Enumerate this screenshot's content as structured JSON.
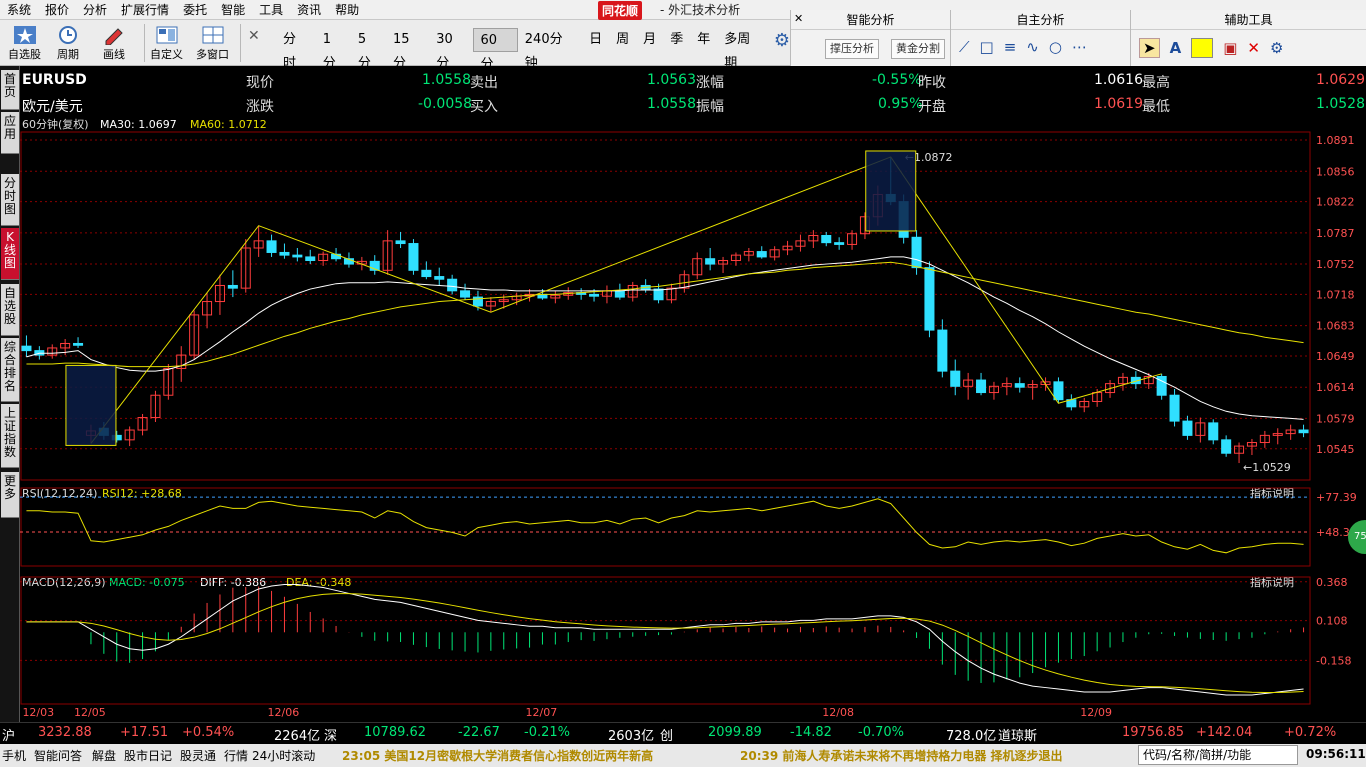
{
  "menu": [
    "系统",
    "报价",
    "分析",
    "扩展行情",
    "委托",
    "智能",
    "工具",
    "资讯",
    "帮助"
  ],
  "app": {
    "brand": "同花顺",
    "title": "- 外汇技术分析"
  },
  "toolbar": {
    "tools": [
      "自选股",
      "周期",
      "画线",
      "自定义",
      "多窗口"
    ],
    "periods": [
      "分时",
      "1分",
      "5分",
      "15分",
      "30分",
      "60分",
      "240分钟",
      "日",
      "周",
      "月",
      "季",
      "年",
      "多周期"
    ],
    "active_period": "60分"
  },
  "panels": {
    "smart": {
      "title": "智能分析",
      "buttons": [
        "撑压分析",
        "黄金分割"
      ]
    },
    "self": {
      "title": "自主分析"
    },
    "aux": {
      "title": "辅助工具"
    }
  },
  "sidetabs": [
    "首页",
    "应用",
    "分时图",
    "K线图",
    "自选股",
    "综合排名",
    "上证指数",
    "更多"
  ],
  "quote": {
    "symbol": "EURUSD",
    "name": "欧元/美元",
    "labels": {
      "now": "现价",
      "change": "涨跌",
      "sell": "卖出",
      "buy": "买入",
      "pct": "涨幅",
      "amp": "振幅",
      "prev": "昨收",
      "open": "开盘",
      "high": "最高",
      "low": "最低"
    },
    "now": "1.0558",
    "change": "-0.0058",
    "sell": "1.0563",
    "buy": "1.0558",
    "pct": "-0.55%",
    "amp": "0.95%",
    "prev": "1.0616",
    "open": "1.0619",
    "high": "1.0629",
    "low": "1.0528"
  },
  "ma_line": {
    "period": "60分钟(复权)",
    "ma30": "MA30: 1.0697",
    "ma60": "MA60: 1.0712"
  },
  "rsi_line": {
    "text": "RSI(12,12,24)",
    "value": "RSI12: +28.68"
  },
  "macd_line": {
    "text": "MACD(12,26,9)",
    "macd": "MACD: -0.075",
    "diff": "DIFF: -0.386",
    "dea": "DEA: -0.348"
  },
  "indicator_help": "指标说明",
  "colors": {
    "up": "#ff3d3d",
    "down": "#30e0ff",
    "ma30": "#ffffff",
    "ma60": "#e6e000",
    "grid": "#8b0000"
  },
  "chart_data": [
    {
      "type": "candlestick",
      "title": "EURUSD 60分钟",
      "x_labels": [
        "12/03",
        "12/05",
        "12/06",
        "12/07",
        "12/08",
        "12/09"
      ],
      "yticks": [
        "1.0891",
        "1.0856",
        "1.0822",
        "1.0787",
        "1.0752",
        "1.0718",
        "1.0683",
        "1.0649",
        "1.0614",
        "1.0579",
        "1.0545"
      ],
      "ylim": [
        1.051,
        1.09
      ],
      "annotations": [
        "1.0872",
        "1.0529"
      ],
      "candles": [
        [
          1.066,
          1.0672,
          1.0648,
          1.0655
        ],
        [
          1.0655,
          1.066,
          1.0645,
          1.065
        ],
        [
          1.065,
          1.0662,
          1.0646,
          1.0658
        ],
        [
          1.0658,
          1.0668,
          1.065,
          1.0663
        ],
        [
          1.0663,
          1.067,
          1.0658,
          1.0661
        ],
        [
          1.056,
          1.0572,
          1.0551,
          1.0565
        ],
        [
          1.0568,
          1.0575,
          1.0555,
          1.056
        ],
        [
          1.056,
          1.0565,
          1.0552,
          1.0555
        ],
        [
          1.0555,
          1.057,
          1.0548,
          1.0566
        ],
        [
          1.0566,
          1.0584,
          1.056,
          1.058
        ],
        [
          1.058,
          1.061,
          1.0575,
          1.0605
        ],
        [
          1.0605,
          1.064,
          1.06,
          1.0635
        ],
        [
          1.0635,
          1.066,
          1.062,
          1.065
        ],
        [
          1.065,
          1.07,
          1.0645,
          1.0695
        ],
        [
          1.0695,
          1.072,
          1.068,
          1.071
        ],
        [
          1.071,
          1.074,
          1.0695,
          1.0728
        ],
        [
          1.0728,
          1.0745,
          1.0715,
          1.0725
        ],
        [
          1.0725,
          1.078,
          1.072,
          1.077
        ],
        [
          1.077,
          1.0795,
          1.076,
          1.0778
        ],
        [
          1.0778,
          1.0785,
          1.076,
          1.0765
        ],
        [
          1.0765,
          1.0775,
          1.0758,
          1.0762
        ],
        [
          1.0762,
          1.077,
          1.0755,
          1.076
        ],
        [
          1.076,
          1.0768,
          1.0752,
          1.0756
        ],
        [
          1.0756,
          1.0766,
          1.075,
          1.0763
        ],
        [
          1.0763,
          1.077,
          1.0755,
          1.0758
        ],
        [
          1.0758,
          1.0765,
          1.0748,
          1.0752
        ],
        [
          1.0752,
          1.076,
          1.0745,
          1.0755
        ],
        [
          1.0755,
          1.0762,
          1.074,
          1.0745
        ],
        [
          1.0745,
          1.079,
          1.074,
          1.0778
        ],
        [
          1.0778,
          1.0788,
          1.077,
          1.0775
        ],
        [
          1.0775,
          1.078,
          1.074,
          1.0745
        ],
        [
          1.0745,
          1.0755,
          1.0735,
          1.0738
        ],
        [
          1.0738,
          1.0748,
          1.0728,
          1.0735
        ],
        [
          1.0735,
          1.074,
          1.0718,
          1.0722
        ],
        [
          1.0722,
          1.073,
          1.0712,
          1.0715
        ],
        [
          1.0715,
          1.0722,
          1.07,
          1.0705
        ],
        [
          1.0705,
          1.0715,
          1.0698,
          1.071
        ],
        [
          1.071,
          1.0718,
          1.0702,
          1.0712
        ],
        [
          1.0712,
          1.072,
          1.0706,
          1.0716
        ],
        [
          1.0716,
          1.0724,
          1.071,
          1.0718
        ],
        [
          1.0718,
          1.0724,
          1.0712,
          1.0714
        ],
        [
          1.0714,
          1.0722,
          1.0708,
          1.0717
        ],
        [
          1.0717,
          1.0726,
          1.0712,
          1.072
        ],
        [
          1.072,
          1.0725,
          1.0712,
          1.0718
        ],
        [
          1.0718,
          1.0724,
          1.071,
          1.0716
        ],
        [
          1.0716,
          1.0728,
          1.0708,
          1.0722
        ],
        [
          1.0722,
          1.073,
          1.0712,
          1.0715
        ],
        [
          1.0715,
          1.0732,
          1.071,
          1.0728
        ],
        [
          1.0728,
          1.0735,
          1.072,
          1.0724
        ],
        [
          1.0724,
          1.073,
          1.0708,
          1.0712
        ],
        [
          1.0712,
          1.073,
          1.0708,
          1.0725
        ],
        [
          1.0725,
          1.0745,
          1.072,
          1.074
        ],
        [
          1.074,
          1.0765,
          1.0735,
          1.0758
        ],
        [
          1.0758,
          1.077,
          1.0745,
          1.0752
        ],
        [
          1.0752,
          1.076,
          1.0742,
          1.0756
        ],
        [
          1.0756,
          1.0765,
          1.075,
          1.0762
        ],
        [
          1.0762,
          1.077,
          1.0755,
          1.0766
        ],
        [
          1.0766,
          1.0772,
          1.0758,
          1.076
        ],
        [
          1.076,
          1.0772,
          1.0756,
          1.0768
        ],
        [
          1.0768,
          1.0778,
          1.0762,
          1.0772
        ],
        [
          1.0772,
          1.0785,
          1.0766,
          1.0778
        ],
        [
          1.0778,
          1.079,
          1.077,
          1.0784
        ],
        [
          1.0784,
          1.0788,
          1.0772,
          1.0776
        ],
        [
          1.0776,
          1.0782,
          1.0768,
          1.0774
        ],
        [
          1.0774,
          1.079,
          1.0768,
          1.0786
        ],
        [
          1.0786,
          1.081,
          1.078,
          1.0805
        ],
        [
          1.0805,
          1.084,
          1.0795,
          1.083
        ],
        [
          1.083,
          1.0872,
          1.0818,
          1.0822
        ],
        [
          1.0822,
          1.083,
          1.0775,
          1.0782
        ],
        [
          1.0782,
          1.079,
          1.074,
          1.0748
        ],
        [
          1.0748,
          1.0755,
          1.067,
          1.0678
        ],
        [
          1.0678,
          1.069,
          1.0625,
          1.0632
        ],
        [
          1.0632,
          1.0645,
          1.0605,
          1.0615
        ],
        [
          1.0615,
          1.063,
          1.06,
          1.0622
        ],
        [
          1.0622,
          1.063,
          1.0605,
          1.0608
        ],
        [
          1.0608,
          1.062,
          1.06,
          1.0615
        ],
        [
          1.0615,
          1.0625,
          1.0605,
          1.0618
        ],
        [
          1.0618,
          1.0625,
          1.0608,
          1.0614
        ],
        [
          1.0614,
          1.0622,
          1.06,
          1.0617
        ],
        [
          1.0617,
          1.0625,
          1.061,
          1.062
        ],
        [
          1.062,
          1.0625,
          1.0596,
          1.06
        ],
        [
          1.06,
          1.0606,
          1.0588,
          1.0592
        ],
        [
          1.0592,
          1.0602,
          1.0586,
          1.0598
        ],
        [
          1.0598,
          1.0612,
          1.0592,
          1.0608
        ],
        [
          1.0608,
          1.0622,
          1.0602,
          1.0618
        ],
        [
          1.0618,
          1.063,
          1.061,
          1.0625
        ],
        [
          1.0625,
          1.0632,
          1.0612,
          1.0618
        ],
        [
          1.0618,
          1.063,
          1.0612,
          1.0626
        ],
        [
          1.0626,
          1.0629,
          1.06,
          1.0605
        ],
        [
          1.0605,
          1.0612,
          1.057,
          1.0576
        ],
        [
          1.0576,
          1.0582,
          1.0555,
          1.056
        ],
        [
          1.056,
          1.058,
          1.0552,
          1.0574
        ],
        [
          1.0574,
          1.0578,
          1.055,
          1.0555
        ],
        [
          1.0555,
          1.056,
          1.0536,
          1.054
        ],
        [
          1.054,
          1.0552,
          1.0529,
          1.0548
        ],
        [
          1.0548,
          1.0556,
          1.0538,
          1.0552
        ],
        [
          1.0552,
          1.0565,
          1.0546,
          1.056
        ],
        [
          1.056,
          1.0568,
          1.055,
          1.0562
        ],
        [
          1.0562,
          1.0572,
          1.0555,
          1.0566
        ],
        [
          1.0566,
          1.0572,
          1.0558,
          1.0563
        ]
      ],
      "ma30": [
        1.0648,
        1.0652,
        1.0652,
        1.0653,
        1.0655,
        1.0645,
        1.064,
        1.0636,
        1.0633,
        1.0632,
        1.0632,
        1.0634,
        1.0638,
        1.0645,
        1.0655,
        1.0665,
        1.0676,
        1.0686,
        1.0697,
        1.0706,
        1.0713,
        1.0719,
        1.0724,
        1.0727,
        1.073,
        1.0731,
        1.0731,
        1.0731,
        1.0732,
        1.0731,
        1.073,
        1.0729,
        1.0728,
        1.0727,
        1.0725,
        1.0724,
        1.0723,
        1.0723,
        1.0722,
        1.0722,
        1.0722,
        1.0722,
        1.0722,
        1.0722,
        1.0722,
        1.0722,
        1.0722,
        1.0723,
        1.0723,
        1.0723,
        1.0724,
        1.0726,
        1.0729,
        1.0732,
        1.0735,
        1.0738,
        1.0741,
        1.0743,
        1.0745,
        1.0747,
        1.0749,
        1.0751,
        1.0752,
        1.0753,
        1.0754,
        1.0756,
        1.0758,
        1.076,
        1.076,
        1.0757,
        1.0752,
        1.0745,
        1.0738,
        1.0731,
        1.0723,
        1.0715,
        1.0708,
        1.07,
        1.0693,
        1.0685,
        1.0676,
        1.0668,
        1.066,
        1.0653,
        1.0646,
        1.064,
        1.0634,
        1.0628,
        1.0621,
        1.0614,
        1.0606,
        1.0598,
        1.0592,
        1.0587,
        1.0584,
        1.0582,
        1.0581,
        1.058,
        1.0579,
        1.0578
      ],
      "ma60": [
        1.064,
        1.064,
        1.064,
        1.0641,
        1.0641,
        1.064,
        1.0639,
        1.0638,
        1.0637,
        1.0637,
        1.0637,
        1.0637,
        1.0638,
        1.064,
        1.0643,
        1.0647,
        1.0651,
        1.0656,
        1.0661,
        1.0666,
        1.0671,
        1.0675,
        1.068,
        1.0684,
        1.0688,
        1.0691,
        1.0695,
        1.0698,
        1.0701,
        1.0704,
        1.0706,
        1.0708,
        1.071,
        1.0711,
        1.0712,
        1.0713,
        1.0714,
        1.0715,
        1.0716,
        1.0717,
        1.0718,
        1.0718,
        1.0719,
        1.072,
        1.0721,
        1.0722,
        1.0723,
        1.0724,
        1.0726,
        1.0727,
        1.0729,
        1.0731,
        1.0733,
        1.0735,
        1.0737,
        1.0739,
        1.0741,
        1.0742,
        1.0743,
        1.0745,
        1.0746,
        1.0748,
        1.0749,
        1.075,
        1.0751,
        1.0752,
        1.0753,
        1.0754,
        1.0752,
        1.0749,
        1.0746,
        1.0743,
        1.074,
        1.0737,
        1.0734,
        1.0731,
        1.0728,
        1.0725,
        1.0722,
        1.0719,
        1.0716,
        1.0713,
        1.071,
        1.0707,
        1.0704,
        1.0701,
        1.0698,
        1.0696,
        1.0693,
        1.069,
        1.0687,
        1.0684,
        1.0681,
        1.0678,
        1.0675,
        1.0673,
        1.067,
        1.0668,
        1.0666,
        1.0664
      ]
    },
    {
      "type": "line",
      "title": "RSI(12,12,24)",
      "yticks": [
        "+77.39",
        "+48.37"
      ],
      "values": [
        66,
        66,
        65,
        65,
        64,
        41,
        40,
        42,
        44,
        46,
        50,
        53,
        58,
        62,
        66,
        70,
        68,
        68,
        73,
        74,
        72,
        70,
        69,
        68,
        67,
        66,
        65,
        60,
        66,
        64,
        57,
        52,
        50,
        48,
        45,
        52,
        54,
        56,
        57,
        55,
        56,
        57,
        58,
        56,
        56,
        58,
        55,
        59,
        60,
        56,
        60,
        62,
        66,
        65,
        66,
        67,
        68,
        66,
        68,
        70,
        72,
        74,
        70,
        68,
        70,
        73,
        76,
        72,
        60,
        48,
        38,
        35,
        36,
        40,
        38,
        40,
        41,
        40,
        41,
        42,
        40,
        37,
        39,
        43,
        45,
        47,
        45,
        46,
        40,
        36,
        34,
        38,
        33,
        31,
        35,
        36,
        38,
        39,
        39,
        38
      ]
    },
    {
      "type": "bar+line",
      "title": "MACD(12,26,9)",
      "yticks": [
        "0.368",
        "0.108",
        "-0.158"
      ],
      "diff": [
        0.1,
        0.1,
        0.1,
        0.1,
        0.1,
        0.05,
        0.0,
        -0.05,
        -0.08,
        -0.09,
        -0.08,
        -0.05,
        0.0,
        0.06,
        0.12,
        0.18,
        0.24,
        0.28,
        0.32,
        0.34,
        0.35,
        0.35,
        0.34,
        0.33,
        0.31,
        0.29,
        0.27,
        0.25,
        0.24,
        0.23,
        0.21,
        0.19,
        0.17,
        0.15,
        0.13,
        0.11,
        0.1,
        0.09,
        0.08,
        0.07,
        0.07,
        0.06,
        0.06,
        0.06,
        0.05,
        0.05,
        0.05,
        0.05,
        0.05,
        0.05,
        0.05,
        0.06,
        0.07,
        0.08,
        0.08,
        0.09,
        0.09,
        0.1,
        0.1,
        0.1,
        0.11,
        0.11,
        0.12,
        0.12,
        0.12,
        0.13,
        0.14,
        0.14,
        0.13,
        0.1,
        0.05,
        -0.03,
        -0.1,
        -0.16,
        -0.21,
        -0.25,
        -0.28,
        -0.31,
        -0.33,
        -0.34,
        -0.35,
        -0.36,
        -0.37,
        -0.37,
        -0.37,
        -0.36,
        -0.35,
        -0.34,
        -0.34,
        -0.35,
        -0.36,
        -0.37,
        -0.38,
        -0.39,
        -0.39,
        -0.39,
        -0.38,
        -0.37,
        -0.36,
        -0.35
      ]
    }
  ],
  "xaxis_labels": [
    "12/03",
    "12/05",
    "12/06",
    "12/07",
    "12/08",
    "12/09"
  ],
  "ticker": {
    "sh": {
      "name": "沪",
      "value": "3232.88",
      "chg": "+17.51",
      "pct": "+0.54%",
      "amt": "2264亿"
    },
    "sz": {
      "name": "深",
      "value": "10789.62",
      "chg": "-22.67",
      "pct": "-0.21%",
      "amt": "2603亿"
    },
    "cy": {
      "name": "创",
      "value": "2099.89",
      "chg": "-14.82",
      "pct": "-0.70%",
      "amt": "728.0亿"
    },
    "dj": {
      "name": "道琼斯",
      "value": "19756.85",
      "chg": "+142.04",
      "pct": "+0.72%"
    }
  },
  "status": {
    "items": [
      "手机",
      "智能问答",
      "解盘",
      "股市日记",
      "股灵通",
      "行情",
      "24小时滚动"
    ],
    "news1": "23:05 美国12月密歇根大学消费者信心指数创近两年新高",
    "news2": "20:39 前海人寿承诺未来将不再增持格力电器 择机逐步退出",
    "code_placeholder": "代码/名称/简拼/功能",
    "time": "09:56:11"
  },
  "badge": "75"
}
